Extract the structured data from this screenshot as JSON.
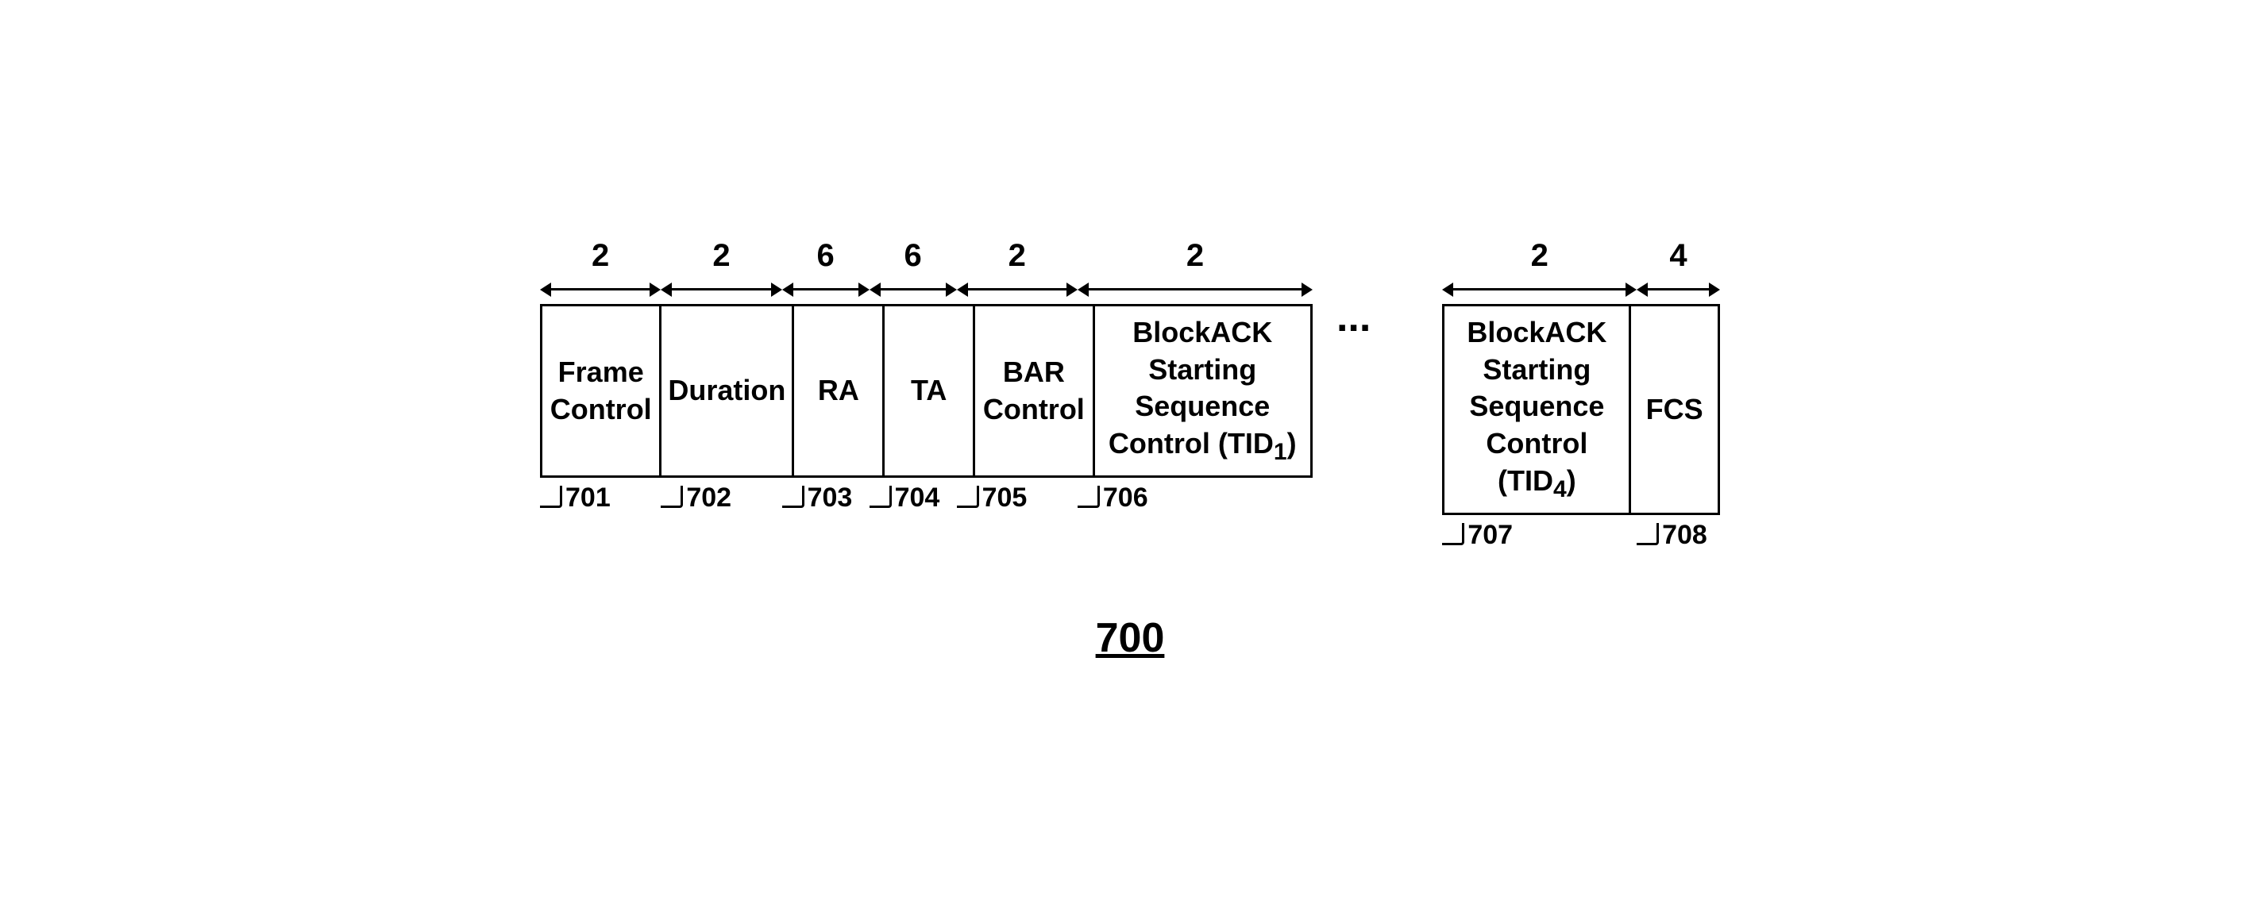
{
  "diagram": {
    "title": "700",
    "main_block": {
      "arrows": [
        {
          "label": "2",
          "flex": "1.8"
        },
        {
          "label": "2",
          "flex": "1.8"
        },
        {
          "label": "6",
          "flex": "1.3"
        },
        {
          "label": "6",
          "flex": "1.3"
        },
        {
          "label": "2",
          "flex": "1.8"
        },
        {
          "label": "2",
          "flex": "3.5"
        }
      ],
      "cells": [
        {
          "id": "fc",
          "text": "Frame\nControl",
          "flex": "1.8",
          "label_id": "701"
        },
        {
          "id": "dur",
          "text": "Duration",
          "flex": "1.8",
          "label_id": "702"
        },
        {
          "id": "ra",
          "text": "RA",
          "flex": "1.3",
          "label_id": "703"
        },
        {
          "id": "ta",
          "text": "TA",
          "flex": "1.3",
          "label_id": "704"
        },
        {
          "id": "bar",
          "text": "BAR\nControl",
          "flex": "1.8",
          "label_id": "705"
        },
        {
          "id": "bss1",
          "text": "BlockACK\nStarting\nSequence\nControl (TID₁)",
          "flex": "3.5",
          "label_id": "706"
        }
      ]
    },
    "right_block": {
      "arrows": [
        {
          "label": "2",
          "flex": "3.5"
        },
        {
          "label": "4",
          "flex": "1.5"
        }
      ],
      "cells": [
        {
          "id": "bss4",
          "text": "BlockACK\nStarting\nSequence\nControl (TID₄)",
          "flex": "3.5",
          "label_id": "707"
        },
        {
          "id": "fcs",
          "text": "FCS",
          "flex": "1.5",
          "label_id": "708"
        }
      ]
    }
  }
}
